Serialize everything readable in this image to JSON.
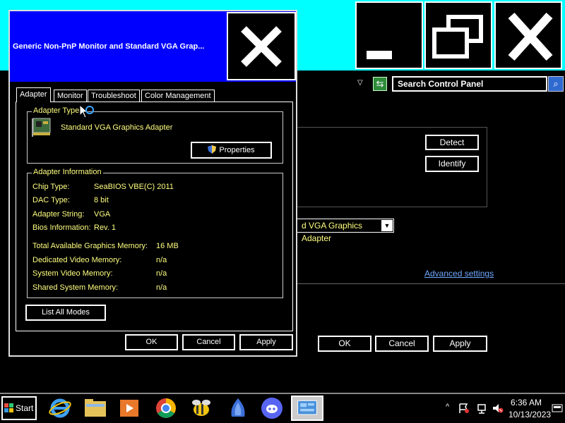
{
  "background_window": {
    "search": {
      "placeholder": "Search Control Panel"
    },
    "detect_label": "Detect",
    "identify_label": "Identify",
    "adapter_select_value": "d VGA Graphics Adapter",
    "advanced_settings_label": "Advanced settings",
    "ok_label": "OK",
    "cancel_label": "Cancel",
    "apply_label": "Apply"
  },
  "dialog": {
    "title": "Generic Non-PnP Monitor and Standard VGA Grap...",
    "tabs": [
      {
        "label": "Adapter"
      },
      {
        "label": "Monitor"
      },
      {
        "label": "Troubleshoot"
      },
      {
        "label": "Color Management"
      }
    ],
    "adapter_type": {
      "group_title": "Adapter Type",
      "name": "Standard VGA Graphics Adapter",
      "properties_label": "Properties"
    },
    "adapter_info": {
      "group_title": "Adapter Information",
      "rows": [
        {
          "label": "Chip Type:",
          "value": "SeaBIOS VBE(C) 2011"
        },
        {
          "label": "DAC Type:",
          "value": "8 bit"
        },
        {
          "label": "Adapter String:",
          "value": "VGA"
        },
        {
          "label": "Bios Information:",
          "value": "Rev. 1"
        }
      ],
      "memory_rows": [
        {
          "label": "Total Available Graphics Memory:",
          "value": "16 MB"
        },
        {
          "label": "Dedicated Video Memory:",
          "value": "n/a"
        },
        {
          "label": "System Video Memory:",
          "value": "n/a"
        },
        {
          "label": "Shared System Memory:",
          "value": "n/a"
        }
      ]
    },
    "list_all_modes_label": "List All Modes",
    "ok_label": "OK",
    "cancel_label": "Cancel",
    "apply_label": "Apply"
  },
  "taskbar": {
    "start_label": "Start",
    "apps": [
      "internet-explorer-icon",
      "file-explorer-icon",
      "media-player-icon",
      "chrome-icon",
      "bee-app-icon",
      "blue-app-icon",
      "discord-icon",
      "control-panel-icon"
    ],
    "clock_time": "6:36 AM",
    "clock_date": "10/13/2023"
  },
  "colors": {
    "titlebar_bg": "#00ffff",
    "dialog_title_bg": "#0000ff",
    "text": "#ffff80",
    "link": "#6ea8ff"
  }
}
